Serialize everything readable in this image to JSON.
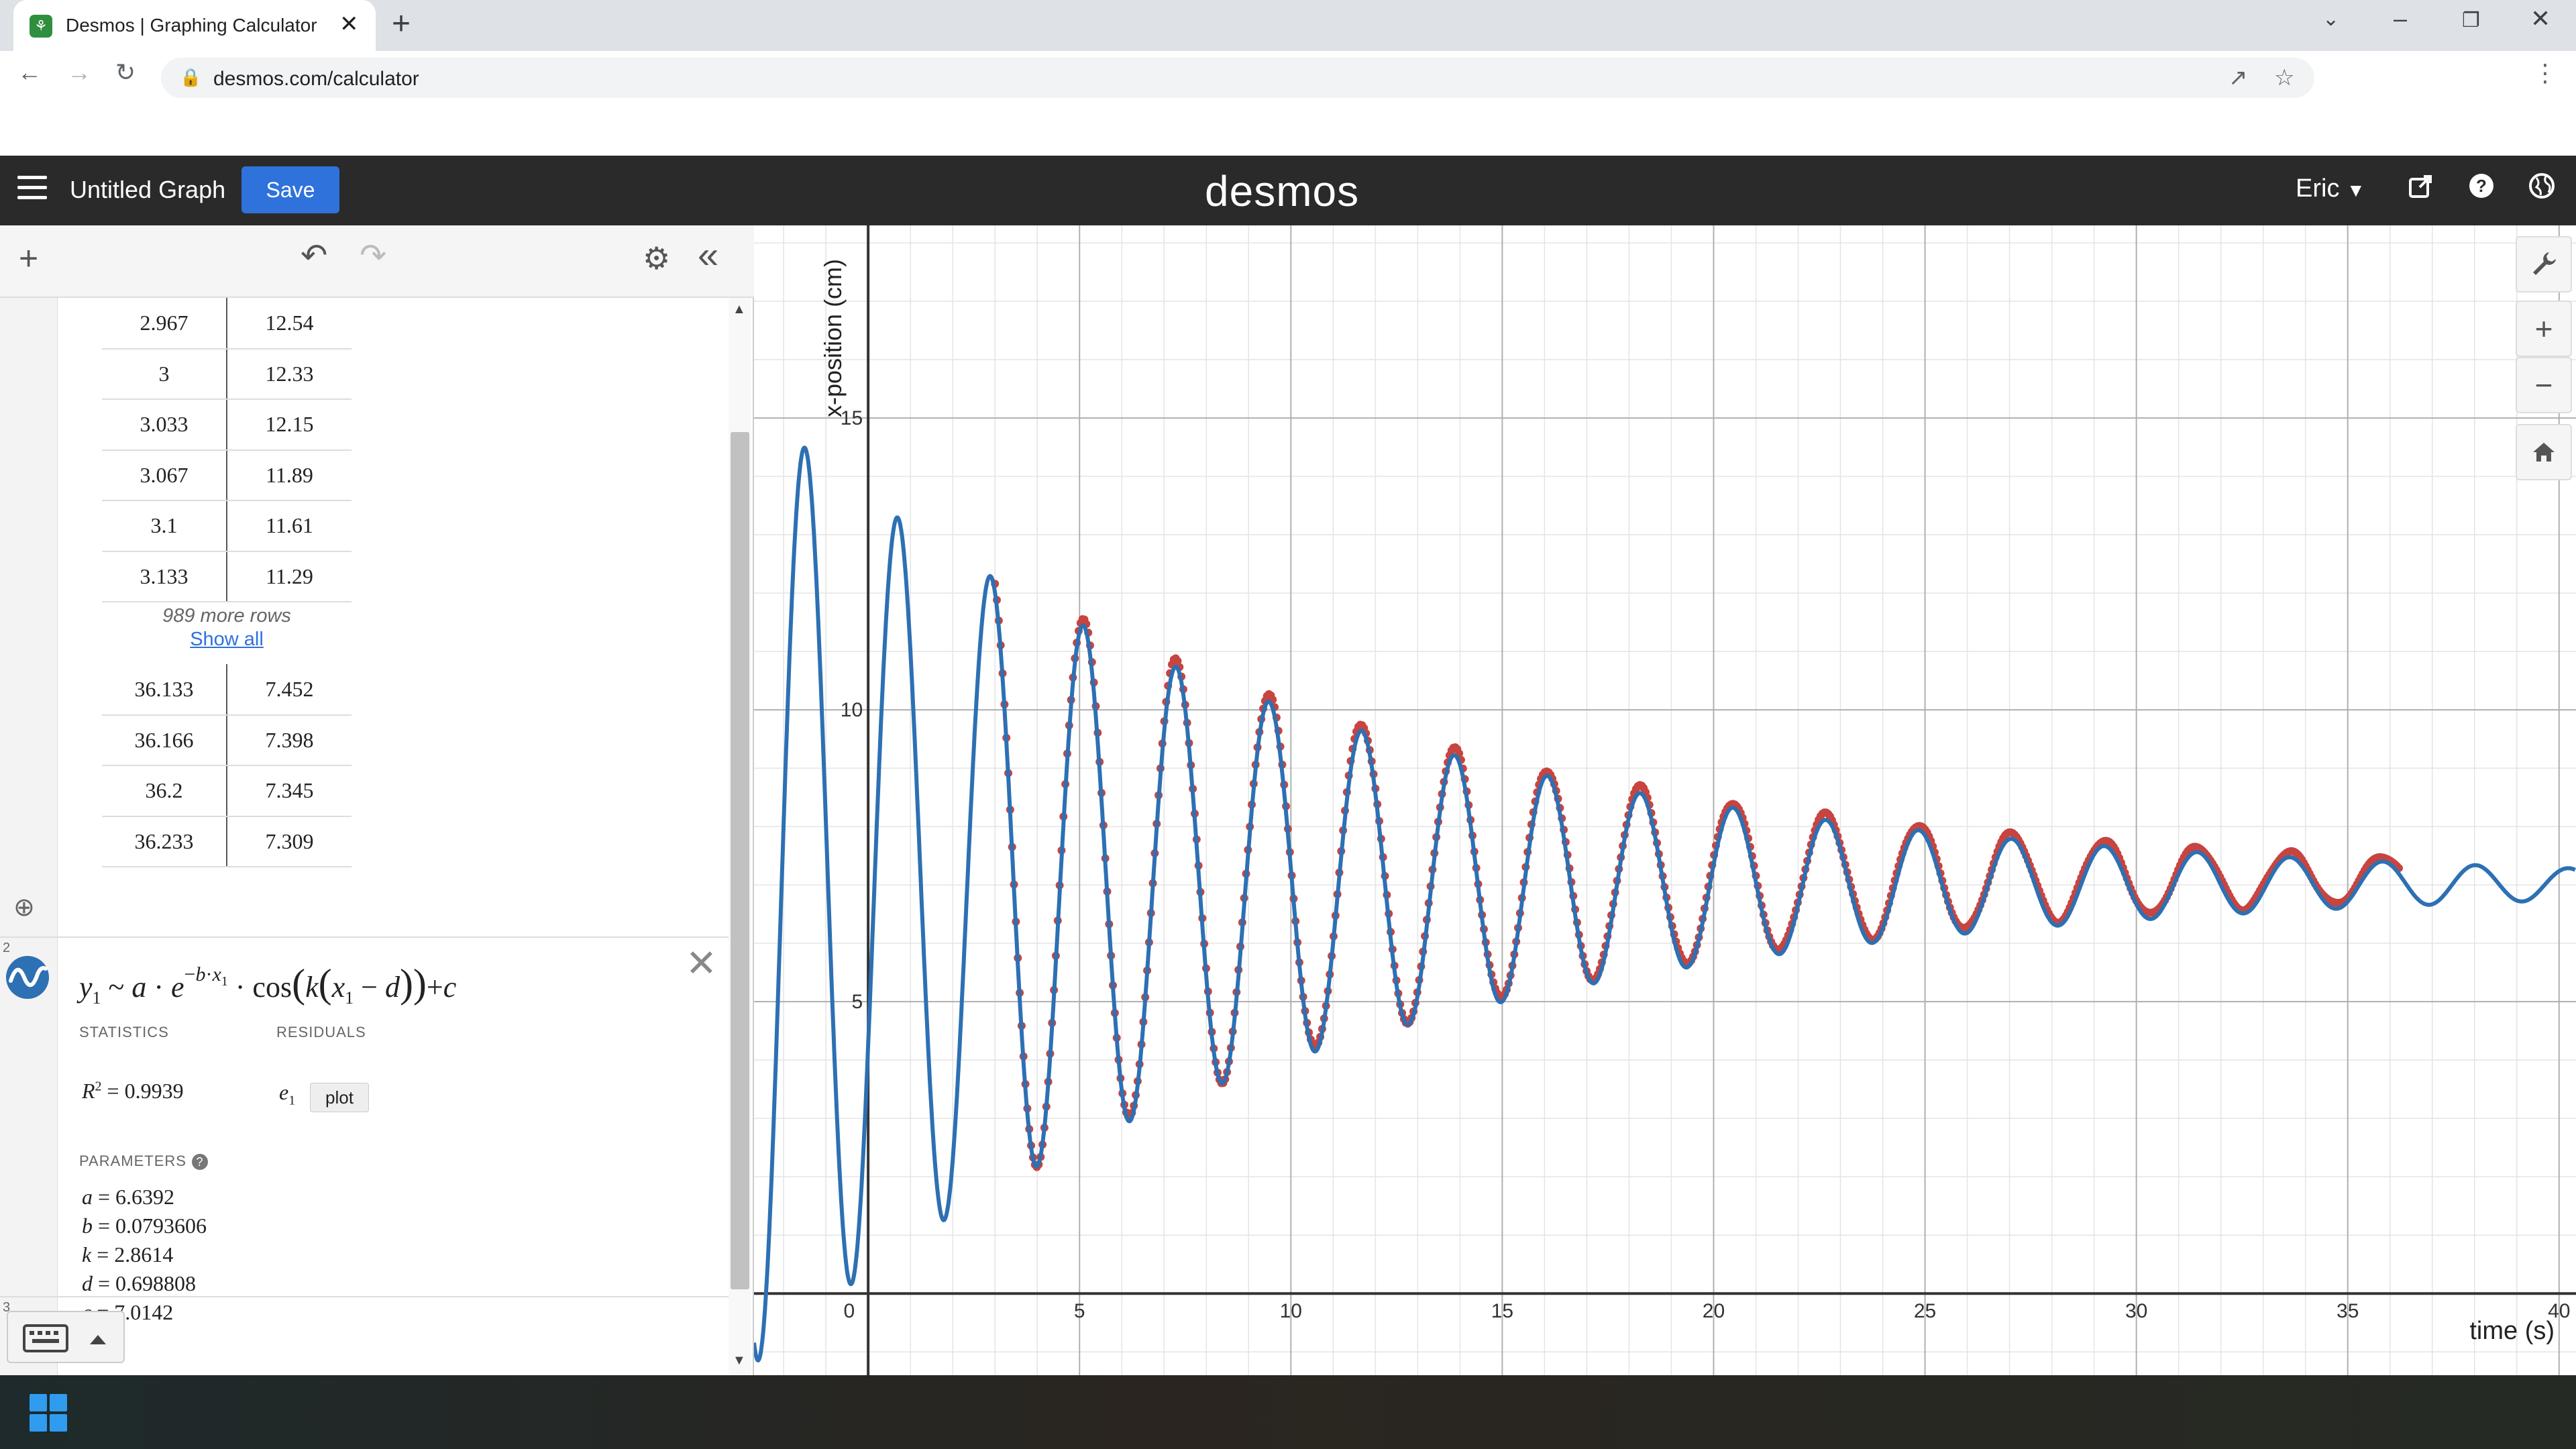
{
  "browser": {
    "tab_title": "Desmos | Graphing Calculator",
    "url": "desmos.com/calculator",
    "icons": [
      "favicon",
      "close-icon",
      "new-tab-icon",
      "chevron-down-icon",
      "minimize-icon",
      "restore-icon",
      "close-window-icon",
      "back-arrow-icon",
      "forward-arrow-icon",
      "reload-icon",
      "lock-icon",
      "share-icon",
      "star-icon",
      "menu-dots-icon"
    ]
  },
  "header": {
    "graph_title": "Untitled Graph",
    "save_label": "Save",
    "logo": "desmos",
    "user": "Eric",
    "icons": [
      "hamburger-icon",
      "share-icon",
      "help-icon",
      "language-globe-icon"
    ],
    "save_color": "#2f72dc"
  },
  "table": {
    "rows_top": [
      [
        "2.967",
        "12.54"
      ],
      [
        "3",
        "12.33"
      ],
      [
        "3.033",
        "12.15"
      ],
      [
        "3.067",
        "11.89"
      ],
      [
        "3.1",
        "11.61"
      ],
      [
        "3.133",
        "11.29"
      ]
    ],
    "more_rows_text": "989 more rows",
    "show_all_label": "Show all",
    "rows_bottom": [
      [
        "36.133",
        "7.452"
      ],
      [
        "36.166",
        "7.398"
      ],
      [
        "36.2",
        "7.345"
      ],
      [
        "36.233",
        "7.309"
      ]
    ]
  },
  "regression": {
    "number": "2",
    "statistics_label": "STATISTICS",
    "residuals_label": "RESIDUALS",
    "r_squared": "0.9939",
    "residual_var": "e",
    "residual_sub": "1",
    "plot_label": "plot",
    "parameters_label": "PARAMETERS",
    "params": [
      {
        "name": "a",
        "value": "6.6392"
      },
      {
        "name": "b",
        "value": "0.0793606"
      },
      {
        "name": "k",
        "value": "2.8614"
      },
      {
        "name": "d",
        "value": "0.698808"
      },
      {
        "name": "c",
        "value": "7.0142"
      }
    ]
  },
  "expression3": {
    "number": "3"
  },
  "graph": {
    "x_axis_label": "time (s)",
    "y_axis_label": "x-position (cm)",
    "x_ticks": [
      "0",
      "5",
      "10",
      "15",
      "20",
      "25",
      "30",
      "35",
      "40"
    ],
    "y_ticks": [
      "5",
      "10",
      "15"
    ],
    "x_range": [
      -2.7,
      40.4
    ],
    "y_range": [
      -1.4,
      18.3
    ],
    "data_color": "#c74440",
    "curve_color": "#2d70b3",
    "model": {
      "a": 6.6392,
      "b": 0.0793606,
      "k": 2.8614,
      "d": 0.698808,
      "c": 7.0142
    },
    "data_domain": [
      3.0,
      36.233
    ],
    "curve_domain": [
      -2.7,
      40.4
    ],
    "icons": [
      "wrench-icon",
      "zoom-in-icon",
      "zoom-out-icon",
      "home-icon"
    ]
  }
}
